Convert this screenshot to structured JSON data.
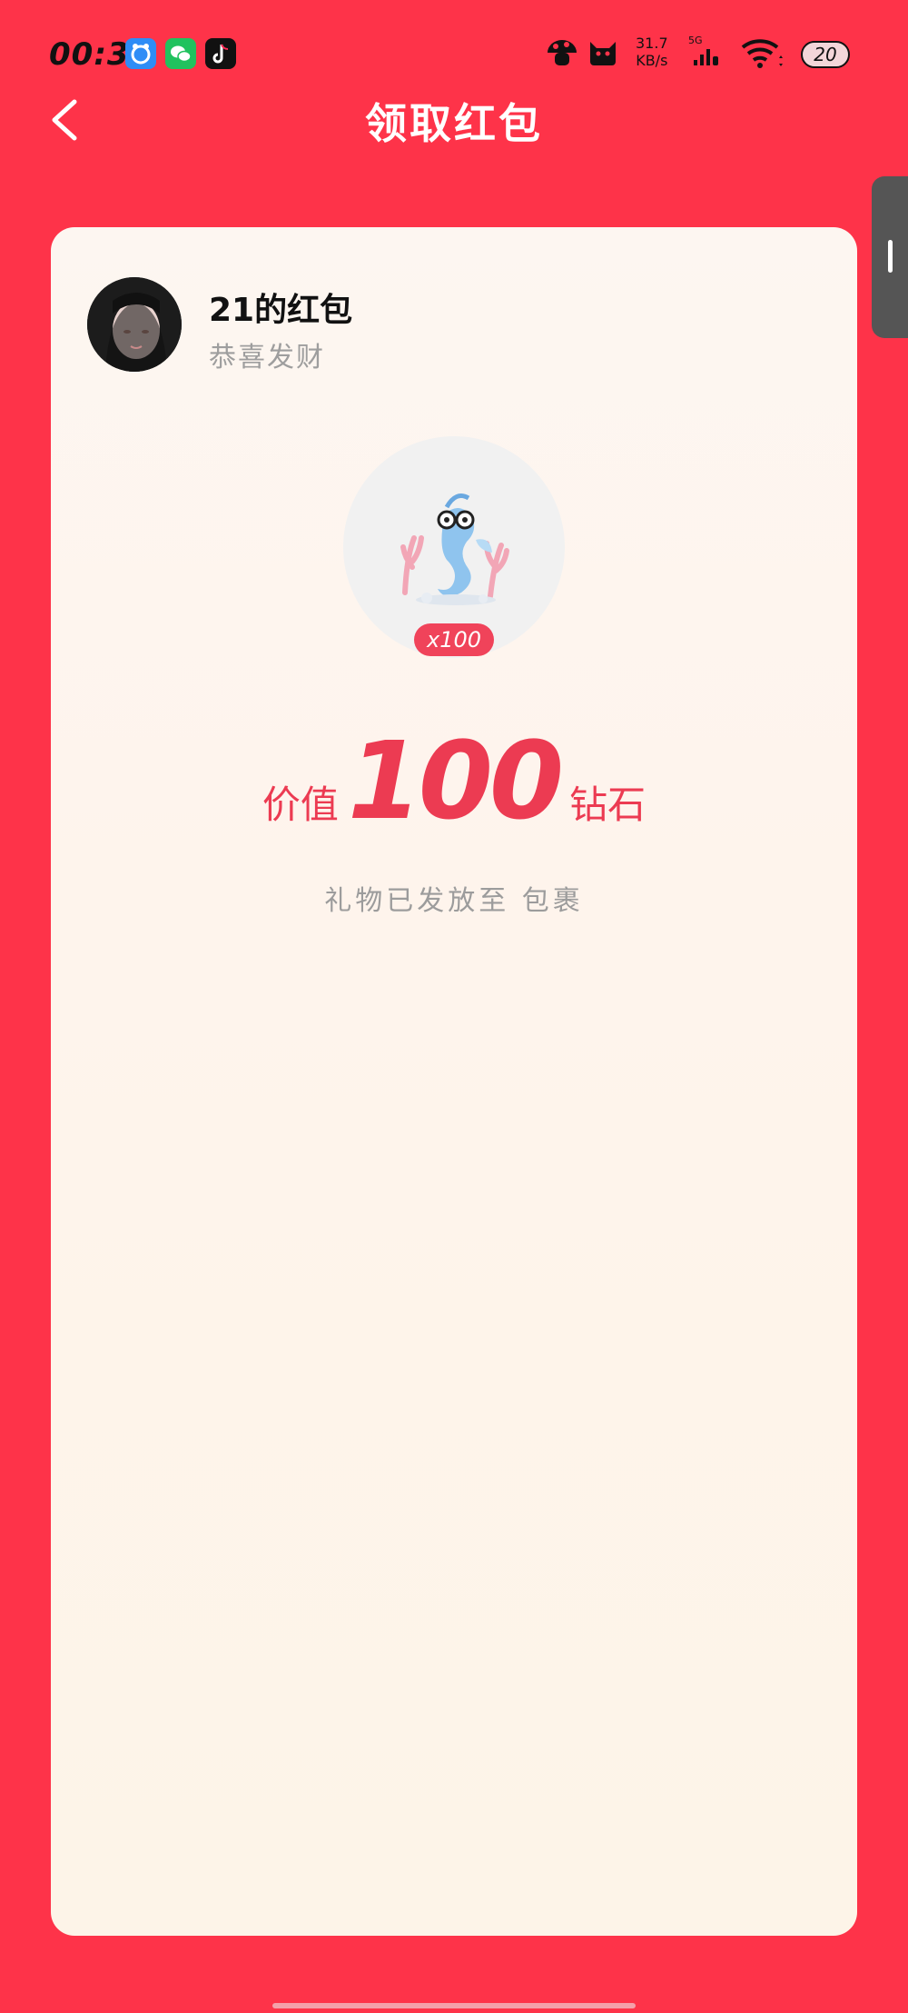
{
  "status_bar": {
    "time": "00:31",
    "network_speed": "31.7",
    "network_speed_unit": "KB/s",
    "signal_label": "5G",
    "battery": "20",
    "app_icons": [
      "baidu-netdisk-icon",
      "wechat-icon",
      "tiktok-icon"
    ],
    "right_icons": [
      "mushroom-icon",
      "cat-icon",
      "signal-icon",
      "wifi-icon",
      "battery-icon"
    ]
  },
  "header": {
    "title": "领取红包",
    "back_icon": "chevron-left-icon"
  },
  "card": {
    "sender_name": "21的红包",
    "greeting": "恭喜发财",
    "gift_count": "x100",
    "value_prefix": "价值",
    "value_amount": "100",
    "value_suffix": "钻石",
    "delivered_text": "礼物已发放至 包裹"
  },
  "colors": {
    "background": "#fe3349",
    "accent": "#ec3b52",
    "card": "#fdf6f1",
    "muted_text": "#9c9c9c"
  }
}
